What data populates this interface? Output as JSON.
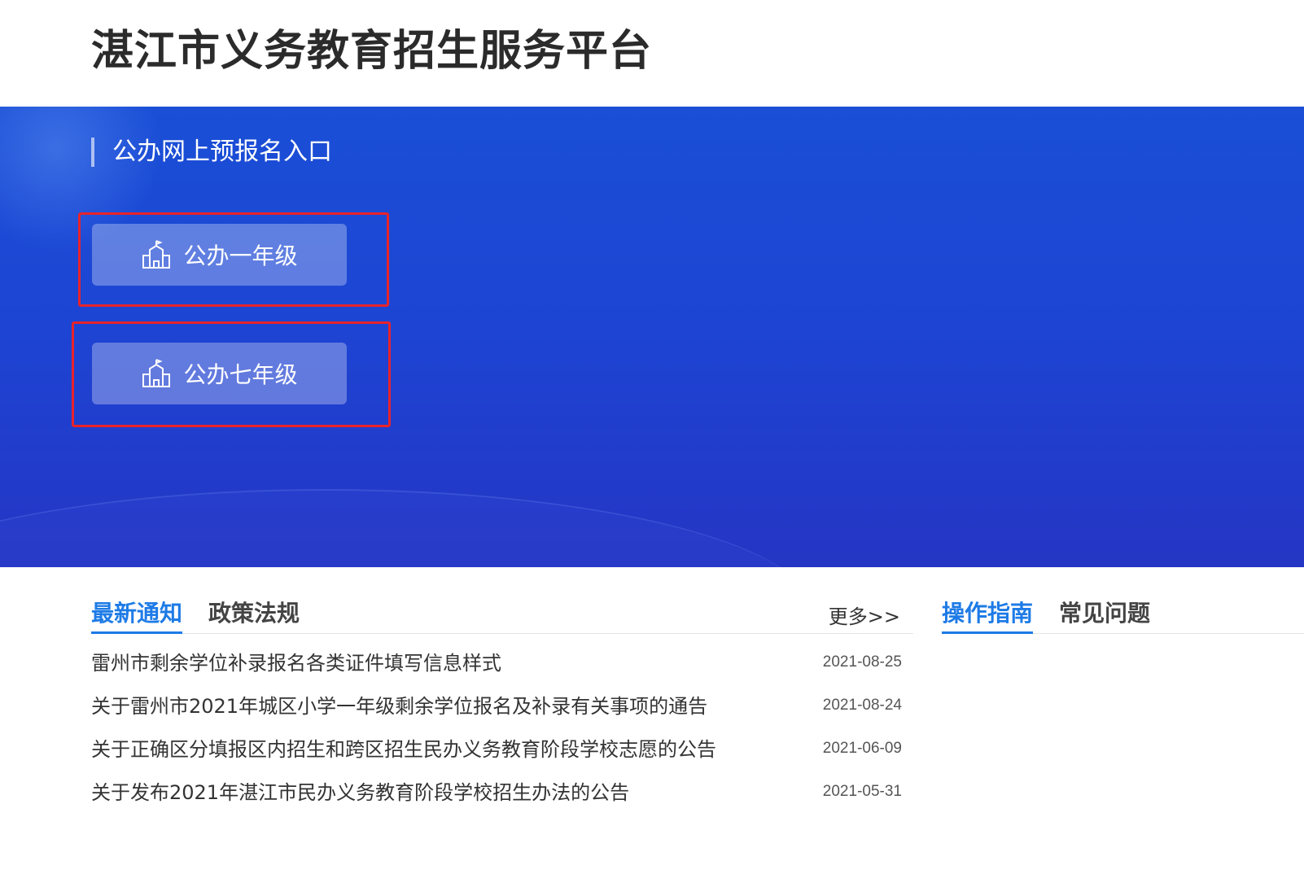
{
  "header": {
    "title": "湛江市义务教育招生服务平台"
  },
  "banner": {
    "section_title": "公办网上预报名入口",
    "buttons": [
      {
        "label": "公办一年级",
        "icon": "school-building-icon"
      },
      {
        "label": "公办七年级",
        "icon": "school-building-icon"
      }
    ],
    "highlight_color": "#e8232a"
  },
  "news": {
    "tabs": [
      {
        "label": "最新通知",
        "active": true
      },
      {
        "label": "政策法规",
        "active": false
      }
    ],
    "more_label": "更多>>",
    "items": [
      {
        "title": "雷州市剩余学位补录报名各类证件填写信息样式",
        "date": "2021-08-25"
      },
      {
        "title": "关于雷州市2021年城区小学一年级剩余学位报名及补录有关事项的通告",
        "date": "2021-08-24"
      },
      {
        "title": "关于正确区分填报区内招生和跨区招生民办义务教育阶段学校志愿的公告",
        "date": "2021-06-09"
      },
      {
        "title": "关于发布2021年湛江市民办义务教育阶段学校招生办法的公告",
        "date": "2021-05-31"
      }
    ]
  },
  "guide": {
    "tabs": [
      {
        "label": "操作指南",
        "active": true
      },
      {
        "label": "常见问题",
        "active": false
      }
    ]
  },
  "colors": {
    "accent": "#1e7be6",
    "banner_top": "#1a4fd6",
    "banner_bottom": "#2535c4"
  }
}
